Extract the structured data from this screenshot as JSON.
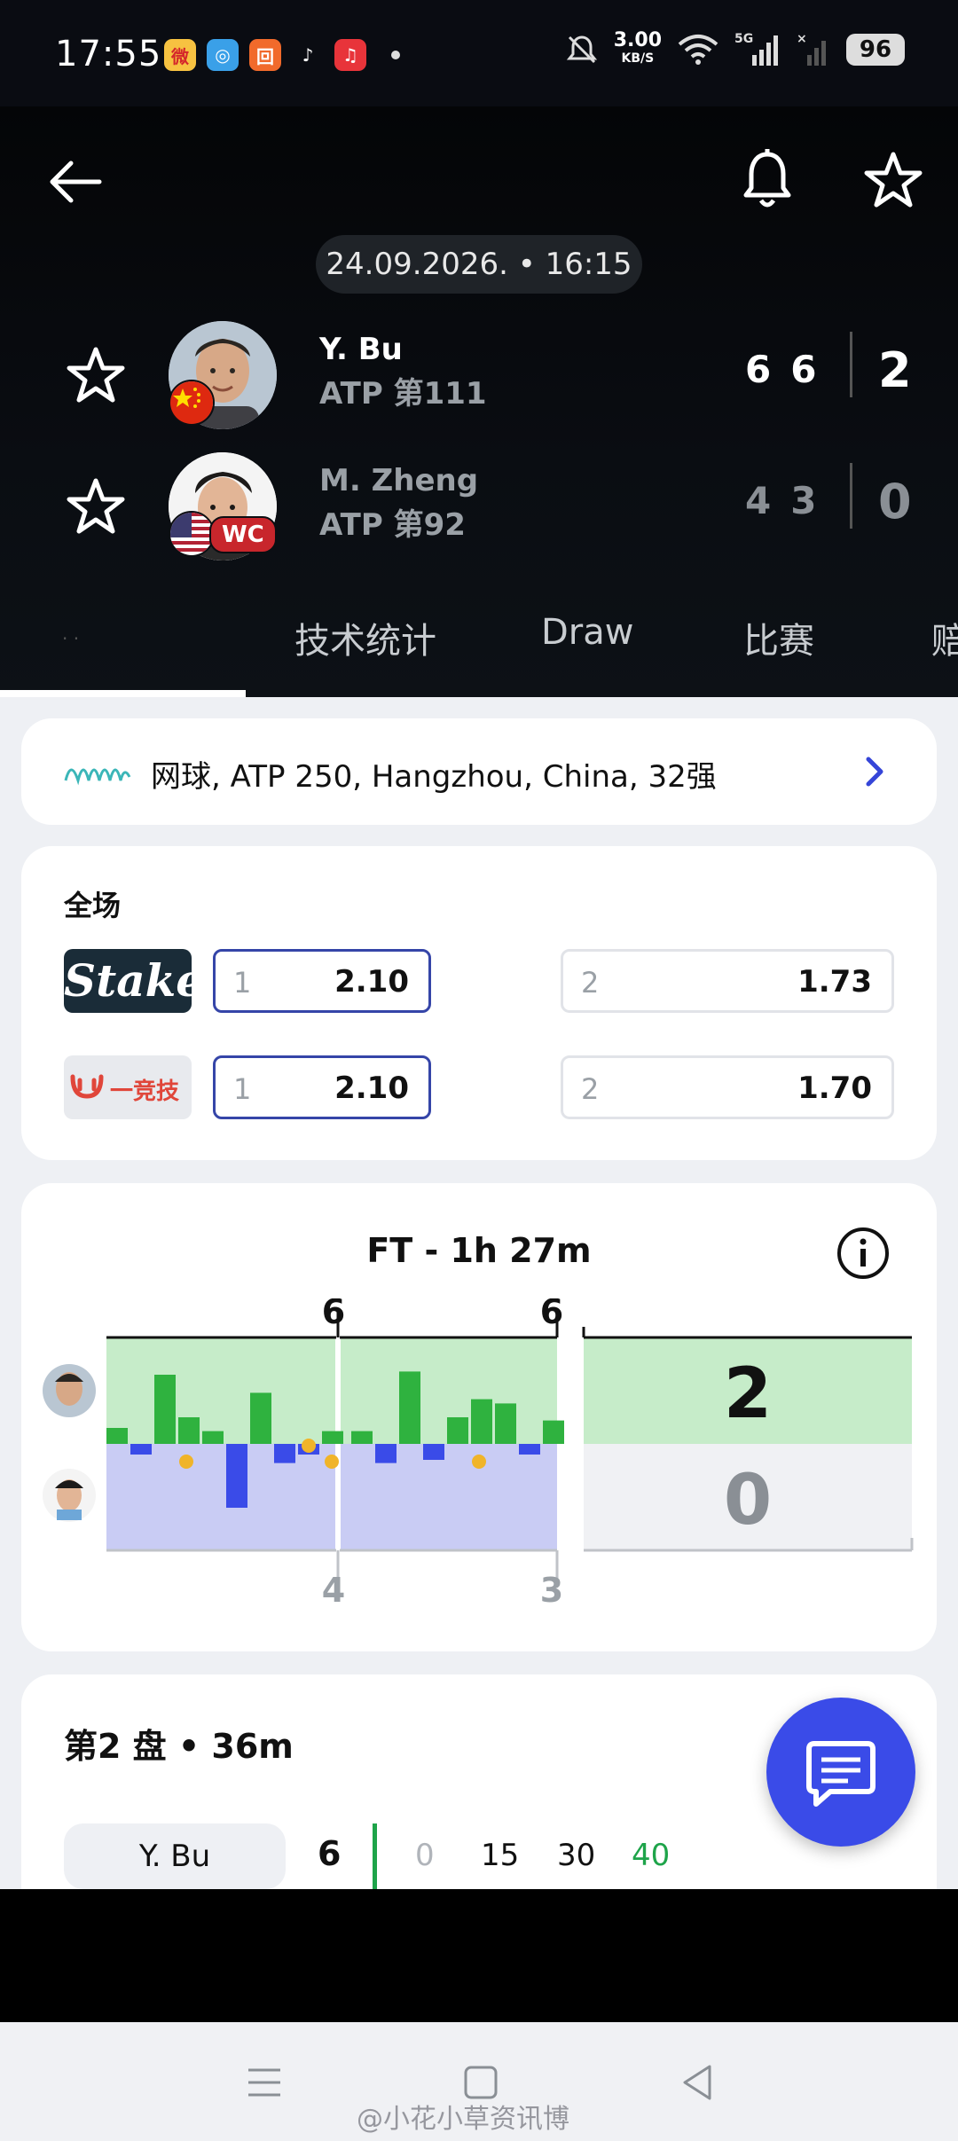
{
  "status_bar": {
    "time": "17:55",
    "net_speed": "3.00",
    "net_unit": "KB/S",
    "network": "5G",
    "battery": "96",
    "app_icons": [
      "weibo-icon",
      "chat-bubble-app-icon",
      "orange-app-icon",
      "tiktok-icon",
      "music-app-icon"
    ]
  },
  "header": {
    "datetime": "24.09.2026. • 16:15",
    "players": [
      {
        "name": "Y. Bu",
        "rank": "ATP 第111",
        "sets": [
          "6",
          "6"
        ],
        "total": "2",
        "flag": "china-flag"
      },
      {
        "name": "M. Zheng",
        "rank": "ATP 第92",
        "sets": [
          "4",
          "3"
        ],
        "total": "0",
        "flag": "usa-flag",
        "badge": "WC"
      }
    ],
    "tabs": [
      "技术统计",
      "Draw",
      "比赛",
      "赔"
    ]
  },
  "tournament": {
    "label": "网球, ATP 250, Hangzhou, China, 32强"
  },
  "odds": {
    "title": "全场",
    "rows": [
      {
        "bookmaker": "Stake",
        "home_label": "1",
        "home_odd": "2.10",
        "away_label": "2",
        "away_odd": "1.73"
      },
      {
        "bookmaker": "一竞技",
        "home_label": "1",
        "home_odd": "2.10",
        "away_label": "2",
        "away_odd": "1.70"
      }
    ]
  },
  "timeline": {
    "title": "FT - 1h 27m",
    "set_scores_top": [
      "6",
      "6"
    ],
    "set_scores_bottom": [
      "4",
      "3"
    ],
    "total_top": "2",
    "total_bottom": "0",
    "momentum": [
      0.15,
      -0.1,
      0.65,
      0.25,
      0.12,
      -0.6,
      0.48,
      -0.18,
      -0.1,
      0.12,
      0.12,
      -0.18,
      0.68,
      -0.15,
      0.25,
      0.42,
      0.38,
      -0.1,
      0.22
    ]
  },
  "game_detail": {
    "title": "第2 盘 • 36m",
    "player": "Y. Bu",
    "games": "6",
    "points": [
      "0",
      "15",
      "30",
      "40"
    ]
  },
  "colors": {
    "accent_blue": "#3a4be8",
    "win_green": "#1ea44a",
    "p1_area": "#c6ecc9",
    "p2_area": "#c9ccf4"
  },
  "watermark": "@小花小草资讯博"
}
